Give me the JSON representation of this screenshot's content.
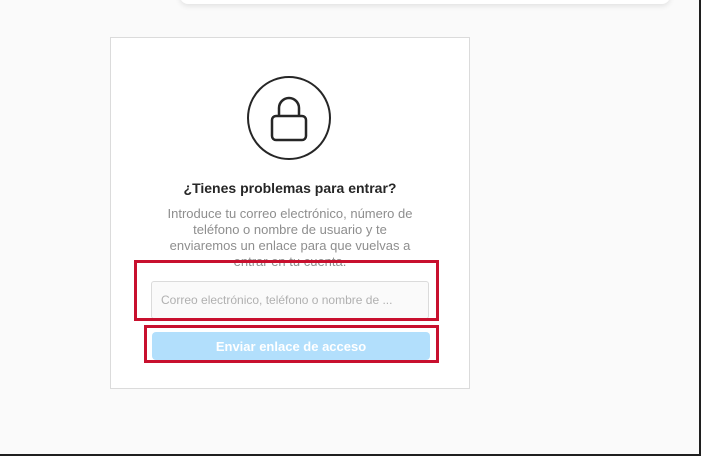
{
  "reset": {
    "title": "¿Tienes problemas para entrar?",
    "description": "Introduce tu correo electrónico, número de teléfono o nombre de usuario y te enviaremos un enlace para que vuelvas a entrar en tu cuenta.",
    "input_placeholder": "Correo electrónico, teléfono o nombre de ...",
    "input_value": "",
    "submit_label": "Enviar enlace de acceso"
  },
  "icons": {
    "lock": "lock-icon"
  },
  "colors": {
    "highlight": "#c8102e",
    "button_disabled": "#b2dffc",
    "title": "#262626",
    "muted_text": "#8e8e8e"
  }
}
